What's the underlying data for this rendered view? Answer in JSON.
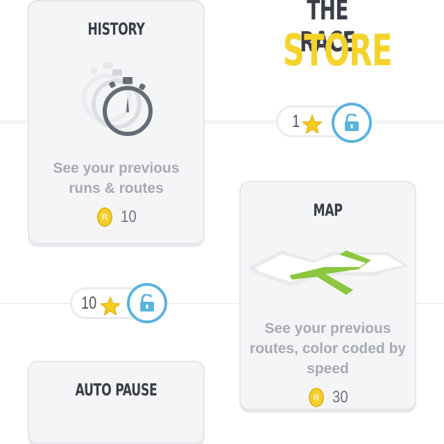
{
  "store": {
    "title_line1": "THE RACE",
    "title_line2": "STORE"
  },
  "cards": {
    "history": {
      "title": "HISTORY",
      "desc_line1": "See your previous",
      "desc_line2": "runs & routes",
      "price": "10",
      "coin_letter": "R",
      "icon": "stopwatch-icon"
    },
    "map": {
      "title": "MAP",
      "desc_line1": "See your previous",
      "desc_line2": "routes, color coded by",
      "desc_line3": "speed",
      "price": "30",
      "coin_letter": "R",
      "icon": "map-route-icon"
    },
    "auto_pause": {
      "title": "AUTO PAUSE"
    }
  },
  "unlocks": [
    {
      "stars": "1",
      "icon": "unlock-icon"
    },
    {
      "stars": "10",
      "icon": "unlock-icon"
    }
  ],
  "colors": {
    "accent_yellow": "#f4d32a",
    "lock_blue": "#5ab3de",
    "route_green": "#8cc63f",
    "title_dark": "#3a3e48",
    "desc_gray": "#a7aab4"
  }
}
